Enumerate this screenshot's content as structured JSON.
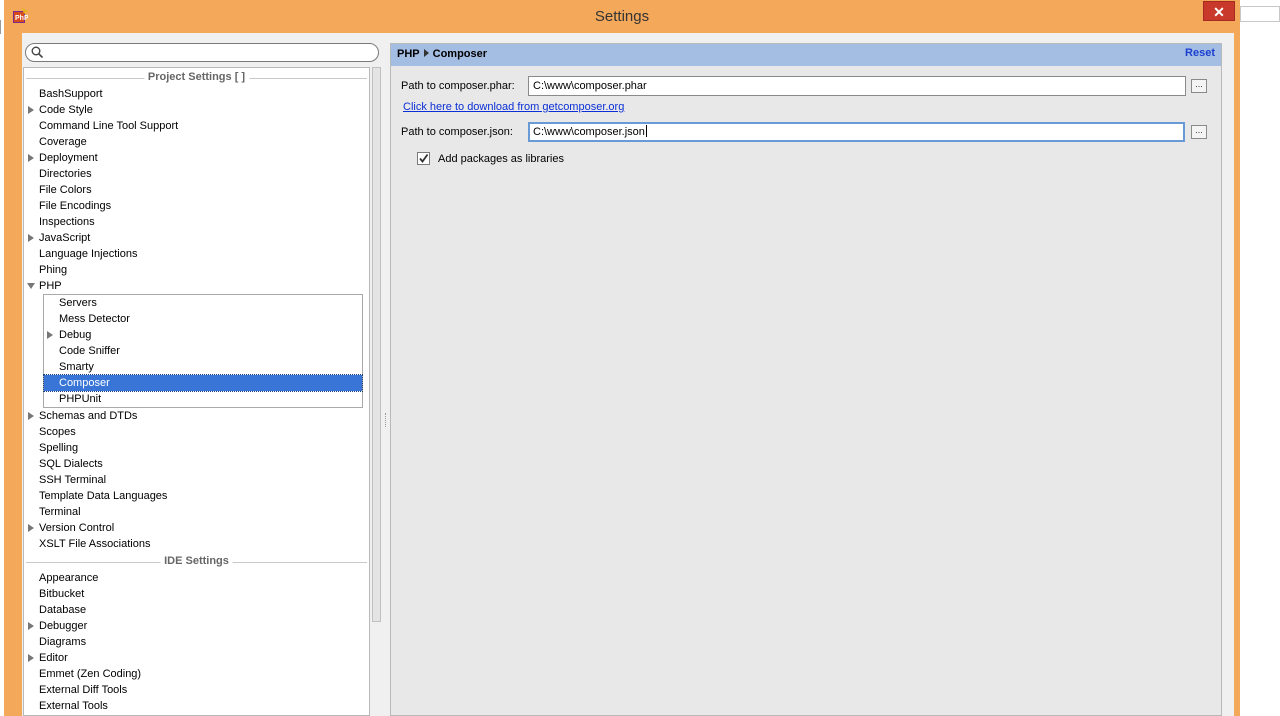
{
  "window": {
    "title": "Settings",
    "close_glyph": "✕",
    "app_icon": "php-storm-icon"
  },
  "search": {
    "value": "",
    "placeholder": ""
  },
  "tree": {
    "project_settings_header": "Project Settings [              ]",
    "project_items": [
      {
        "label": "BashSupport",
        "expandable": false
      },
      {
        "label": "Code Style",
        "expandable": true
      },
      {
        "label": "Command Line Tool Support",
        "expandable": false
      },
      {
        "label": "Coverage",
        "expandable": false
      },
      {
        "label": "Deployment",
        "expandable": true
      },
      {
        "label": "Directories",
        "expandable": false
      },
      {
        "label": "File Colors",
        "expandable": false
      },
      {
        "label": "File Encodings",
        "expandable": false
      },
      {
        "label": "Inspections",
        "expandable": false
      },
      {
        "label": "JavaScript",
        "expandable": true
      },
      {
        "label": "Language Injections",
        "expandable": false
      },
      {
        "label": "Phing",
        "expandable": false
      },
      {
        "label": "PHP",
        "expandable": true,
        "expanded": true
      }
    ],
    "php_children": [
      {
        "label": "Servers",
        "expandable": false
      },
      {
        "label": "Mess Detector",
        "expandable": false
      },
      {
        "label": "Debug",
        "expandable": true
      },
      {
        "label": "Code Sniffer",
        "expandable": false
      },
      {
        "label": "Smarty",
        "expandable": false
      },
      {
        "label": "Composer",
        "expandable": false,
        "selected": true
      },
      {
        "label": "PHPUnit",
        "expandable": false
      }
    ],
    "project_items_after": [
      {
        "label": "Schemas and DTDs",
        "expandable": true
      },
      {
        "label": "Scopes",
        "expandable": false
      },
      {
        "label": "Spelling",
        "expandable": false
      },
      {
        "label": "SQL Dialects",
        "expandable": false
      },
      {
        "label": "SSH Terminal",
        "expandable": false
      },
      {
        "label": "Template Data Languages",
        "expandable": false
      },
      {
        "label": "Terminal",
        "expandable": false
      },
      {
        "label": "Version Control",
        "expandable": true
      },
      {
        "label": "XSLT File Associations",
        "expandable": false
      }
    ],
    "ide_settings_header": "IDE Settings",
    "ide_items": [
      {
        "label": "Appearance",
        "expandable": false
      },
      {
        "label": "Bitbucket",
        "expandable": false
      },
      {
        "label": "Database",
        "expandable": false
      },
      {
        "label": "Debugger",
        "expandable": true
      },
      {
        "label": "Diagrams",
        "expandable": false
      },
      {
        "label": "Editor",
        "expandable": true
      },
      {
        "label": "Emmet (Zen Coding)",
        "expandable": false
      },
      {
        "label": "External Diff Tools",
        "expandable": false
      },
      {
        "label": "External Tools",
        "expandable": false
      }
    ]
  },
  "panel": {
    "breadcrumb_root": "PHP",
    "breadcrumb_leaf": "Composer",
    "reset_label": "Reset",
    "phar_label": "Path to composer.phar:",
    "phar_value": "C:\\www\\composer.phar",
    "download_link": "Click here to download from getcomposer.org",
    "json_label": "Path to composer.json:",
    "json_value": "C:\\www\\composer.json",
    "browse_label": "...",
    "add_packages_label": "Add packages as libraries",
    "add_packages_checked": true
  },
  "colors": {
    "window_frame": "#f4a95a",
    "close_button": "#c8392b",
    "selection": "#3875d7",
    "header_bar": "#a3bde3",
    "link": "#0b2fd6"
  }
}
